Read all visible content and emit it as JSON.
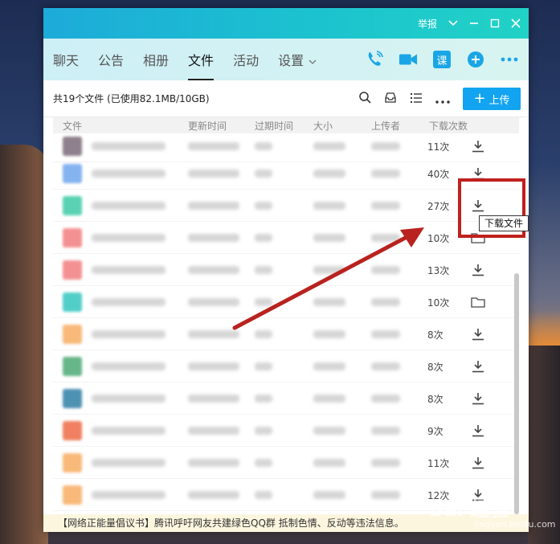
{
  "titlebar": {
    "report_label": "举报"
  },
  "nav": {
    "tabs": [
      {
        "label": "聊天"
      },
      {
        "label": "公告"
      },
      {
        "label": "相册"
      },
      {
        "label": "文件"
      },
      {
        "label": "活动"
      },
      {
        "label": "设置"
      }
    ],
    "active_tab": "文件",
    "ke_label": "课"
  },
  "toolbar": {
    "summary": "共19个文件 (已使用82.1MB/10GB)",
    "upload_label": "上传"
  },
  "columns": [
    "文件",
    "更新时间",
    "过期时间",
    "大小",
    "上传者",
    "下载次数"
  ],
  "rows": [
    {
      "count": "11次",
      "action": "download",
      "thumb_color": "#7b6b78"
    },
    {
      "count": "40次",
      "action": "download",
      "thumb_color": "#6fa6ee"
    },
    {
      "count": "27次",
      "action": "download",
      "thumb_color": "#3ecaa6"
    },
    {
      "count": "10次",
      "action": "folder",
      "thumb_color": "#f27e80"
    },
    {
      "count": "13次",
      "action": "download",
      "thumb_color": "#f27e80"
    },
    {
      "count": "10次",
      "action": "folder",
      "thumb_color": "#34c6bf"
    },
    {
      "count": "8次",
      "action": "download",
      "thumb_color": "#f7ad63"
    },
    {
      "count": "8次",
      "action": "download",
      "thumb_color": "#4daa76"
    },
    {
      "count": "8次",
      "action": "download",
      "thumb_color": "#2f7fa6"
    },
    {
      "count": "9次",
      "action": "download",
      "thumb_color": "#ee6a44"
    },
    {
      "count": "11次",
      "action": "download",
      "thumb_color": "#f7ad63"
    },
    {
      "count": "12次",
      "action": "download",
      "thumb_color": "#f7ad63"
    }
  ],
  "tooltip": "下载文件",
  "footer": "【网络正能量倡议书】腾讯呼吁网友共建绿色QQ群 抵制色情、反动等违法信息。",
  "watermark": "Bai 经验",
  "watermark_sub": "jingyan.baidu.com",
  "colors": {
    "accent": "#12a4f0",
    "annotation_red": "#c0201e",
    "titlebar_start": "#1dabd9",
    "titlebar_end": "#21d2c6"
  }
}
